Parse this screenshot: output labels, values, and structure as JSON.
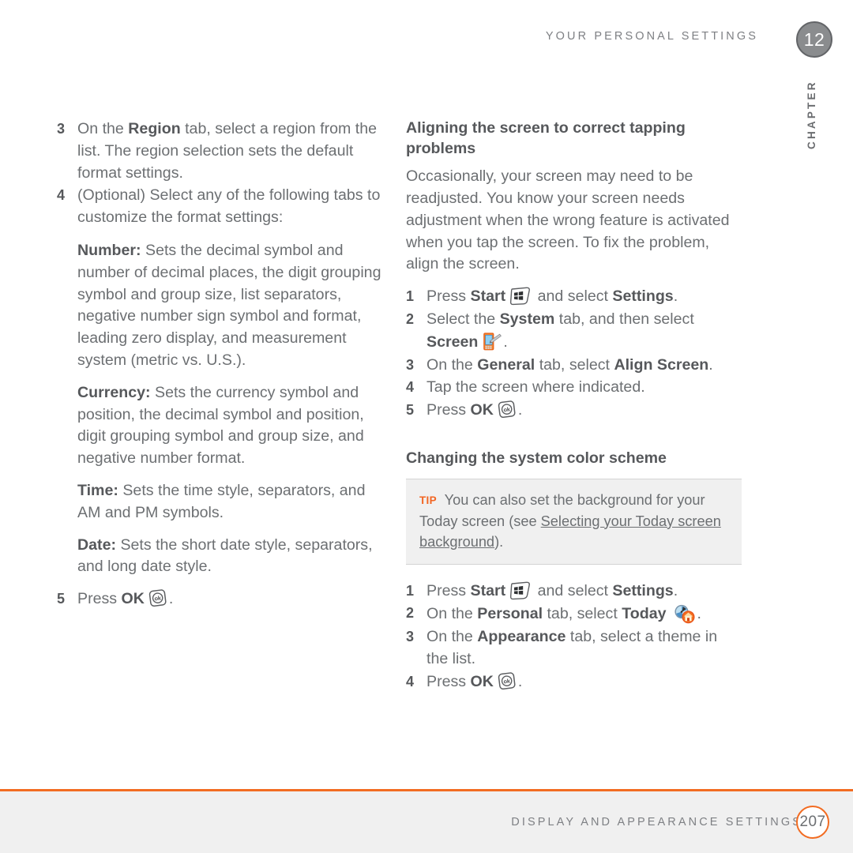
{
  "header": {
    "running_head": "YOUR PERSONAL SETTINGS",
    "chapter_number": "12",
    "chapter_word": "CHAPTER"
  },
  "left_column": {
    "step3": {
      "number": "3",
      "text_before": "On the ",
      "bold1": "Region",
      "text_after": " tab, select a region from the list. The region selection sets the default format settings."
    },
    "step4": {
      "number": "4",
      "text": "(Optional) Select any of the following tabs to customize the format settings:"
    },
    "definitions": [
      {
        "term": "Number:",
        "text": " Sets the decimal symbol and number of decimal places, the digit grouping symbol and group size, list separators, negative number sign symbol and format, leading zero display, and measurement system (metric vs. U.S.)."
      },
      {
        "term": "Currency:",
        "text": " Sets the currency symbol and position, the decimal symbol and position, digit grouping symbol and group size, and negative number format."
      },
      {
        "term": "Time:",
        "text": " Sets the time style, separators, and AM and PM symbols."
      },
      {
        "term": "Date:",
        "text": " Sets the short date style, separators, and long date style."
      }
    ],
    "step5": {
      "number": "5",
      "text_before": "Press ",
      "bold": "OK",
      "icon": "ok-key-icon",
      "text_after": "."
    }
  },
  "right_column": {
    "heading1": "Aligning the screen to correct tapping problems",
    "intro": "Occasionally, your screen may need to be readjusted. You know your screen needs adjustment when the wrong feature is activated when you tap the screen. To fix the problem, align the screen.",
    "steps1": [
      {
        "number": "1",
        "parts": [
          "Press ",
          "Start",
          " and select ",
          "Settings",
          "."
        ],
        "icon": "start-key-icon"
      },
      {
        "number": "2",
        "parts": [
          "Select the ",
          "System",
          " tab, and then select ",
          "Screen",
          "."
        ],
        "icon": "screen-settings-icon"
      },
      {
        "number": "3",
        "parts": [
          "On the ",
          "General",
          " tab, select ",
          "Align Screen",
          "."
        ]
      },
      {
        "number": "4",
        "parts": [
          "Tap the screen where indicated."
        ]
      },
      {
        "number": "5",
        "parts": [
          "Press ",
          "OK",
          "."
        ],
        "icon": "ok-key-icon"
      }
    ],
    "heading2": "Changing the system color scheme",
    "tip": {
      "label": "TIP",
      "text_before": " You can also set the background for your Today screen (see ",
      "link": "Selecting your Today screen background",
      "text_after": ")."
    },
    "steps2": [
      {
        "number": "1",
        "parts": [
          "Press ",
          "Start",
          " and select ",
          "Settings",
          "."
        ],
        "icon": "start-key-icon"
      },
      {
        "number": "2",
        "parts": [
          "On the ",
          "Personal",
          " tab, select ",
          "Today",
          "."
        ],
        "icon": "today-settings-icon"
      },
      {
        "number": "3",
        "parts": [
          "On the ",
          "Appearance",
          " tab, select a theme in the list."
        ]
      },
      {
        "number": "4",
        "parts": [
          "Press ",
          "OK",
          "."
        ],
        "icon": "ok-key-icon"
      }
    ]
  },
  "footer": {
    "running_foot": "DISPLAY AND APPEARANCE SETTINGS",
    "page_number": "207"
  },
  "colors": {
    "accent_orange": "#f26c22",
    "tip_orange": "#f26522",
    "body_gray": "#6c6f72",
    "bold_gray": "#56585b",
    "band_gray": "#f0f0f0",
    "chapter_gray": "#8a8c8e"
  }
}
